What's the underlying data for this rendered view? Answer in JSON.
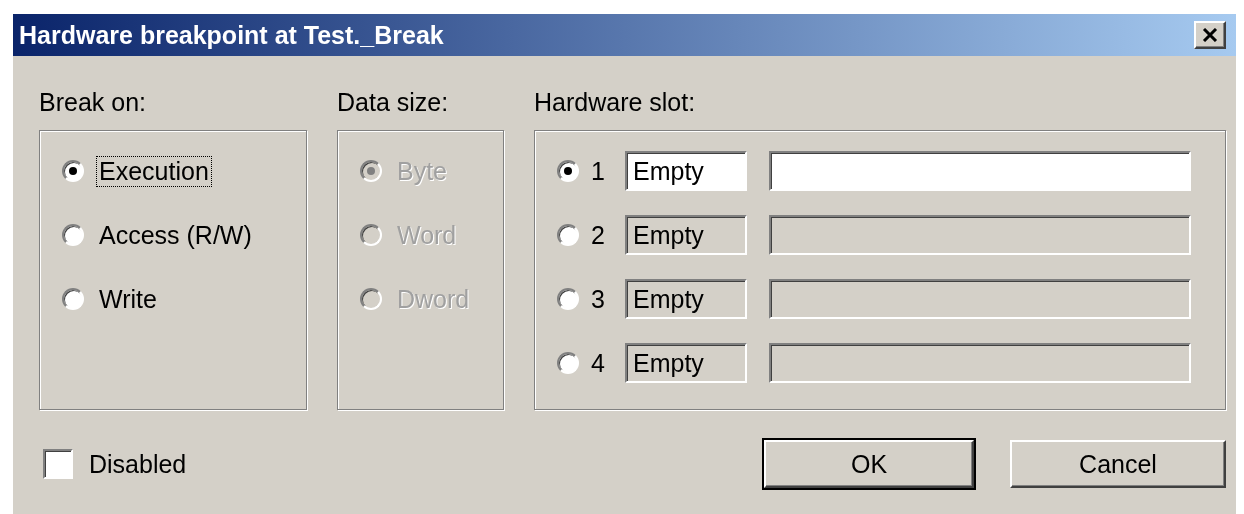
{
  "window": {
    "title": "Hardware breakpoint at Test._Break"
  },
  "break_on": {
    "label": "Break on:",
    "disabled": false,
    "options": [
      {
        "label": "Execution",
        "selected": true,
        "focused": true
      },
      {
        "label": "Access (R/W)",
        "selected": false,
        "focused": false
      },
      {
        "label": "Write",
        "selected": false,
        "focused": false
      }
    ]
  },
  "data_size": {
    "label": "Data size:",
    "disabled": true,
    "options": [
      {
        "label": "Byte",
        "selected": true,
        "focused": false
      },
      {
        "label": "Word",
        "selected": false,
        "focused": false
      },
      {
        "label": "Dword",
        "selected": false,
        "focused": false
      }
    ]
  },
  "hardware_slot": {
    "label": "Hardware slot:",
    "slots": [
      {
        "number": "1",
        "status": "Empty",
        "selected": true,
        "enabled": true
      },
      {
        "number": "2",
        "status": "Empty",
        "selected": false,
        "enabled": false
      },
      {
        "number": "3",
        "status": "Empty",
        "selected": false,
        "enabled": false
      },
      {
        "number": "4",
        "status": "Empty",
        "selected": false,
        "enabled": false
      }
    ]
  },
  "disabled_checkbox": {
    "label": "Disabled",
    "checked": false
  },
  "buttons": [
    {
      "label": "OK",
      "default": true
    },
    {
      "label": "Cancel",
      "default": false
    }
  ]
}
